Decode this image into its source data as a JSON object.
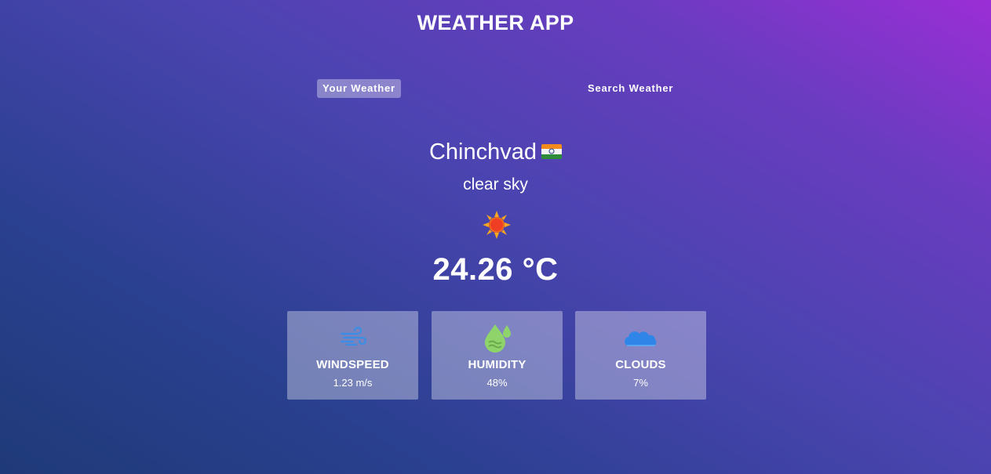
{
  "app": {
    "title": "WEATHER APP"
  },
  "tabs": [
    {
      "label": "Your Weather",
      "active": true
    },
    {
      "label": "Search Weather",
      "active": false
    }
  ],
  "location": {
    "city": "Chinchvad",
    "country_flag": "india-flag-icon"
  },
  "weather": {
    "description": "clear sky",
    "icon": "sun-icon",
    "temperature": "24.26 °C"
  },
  "stats": [
    {
      "label": "WINDSPEED",
      "value": "1.23 m/s",
      "icon": "wind-icon"
    },
    {
      "label": "HUMIDITY",
      "value": "48%",
      "icon": "humidity-icon"
    },
    {
      "label": "CLOUDS",
      "value": "7%",
      "icon": "cloud-icon"
    }
  ],
  "colors": {
    "gradient_start": "#1f3a78",
    "gradient_end": "#9b2ed6",
    "card_bg": "rgba(255,255,255,0.35)",
    "wind_icon": "#3a8ee6",
    "humidity_icon": "#8fd46a",
    "cloud_icon": "#2f86e8",
    "sun_icon": "#f5a623"
  }
}
